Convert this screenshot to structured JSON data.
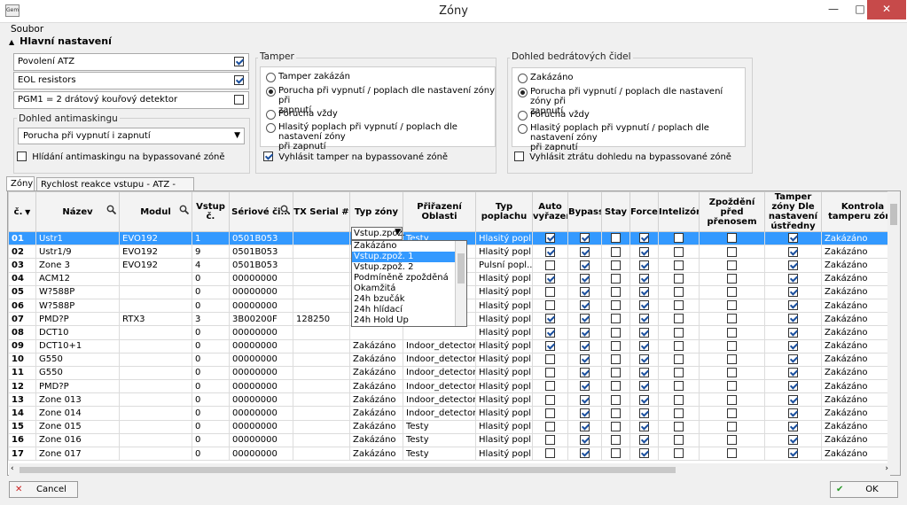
{
  "window": {
    "title": "Zóny",
    "app_icon": "Gem",
    "min": "—",
    "max": "□",
    "close": "✕"
  },
  "menu": {
    "file": "Soubor"
  },
  "main_section": {
    "title": "Hlavní nastavení",
    "collapse_arrow": "▲"
  },
  "left": {
    "items": [
      {
        "label": "Povolení ATZ",
        "checked": true
      },
      {
        "label": "EOL resistors",
        "checked": true
      },
      {
        "label": "PGM1 = 2 drátový kouřový detektor",
        "checked": false
      }
    ],
    "antimask_label": "Dohled antimaskingu",
    "antimask_value": "Porucha při vypnutí i zapnutí",
    "antimask_bypass": "Hlídání antimaskingu na bypassované zóně"
  },
  "tamper": {
    "label": "Tamper",
    "options": [
      {
        "l1": "Tamper zakázán",
        "l2": "",
        "selected": false
      },
      {
        "l1": "Porucha při vypnutí / poplach dle nastavení zóny při",
        "l2": "zapnutí",
        "selected": true
      },
      {
        "l1": "Porucha vždy",
        "l2": "",
        "selected": false
      },
      {
        "l1": "Hlasitý poplach při vypnutí /  poplach dle nastavení zóny",
        "l2": "při zapnutí",
        "selected": false
      }
    ],
    "bypass": "Vyhlásit tamper na bypassované zóně"
  },
  "supervision": {
    "label": "Dohled bedrátových čidel",
    "options": [
      {
        "l1": "Zakázáno",
        "l2": "",
        "selected": false
      },
      {
        "l1": "Porucha při vypnutí / poplach dle nastavení zóny při",
        "l2": "zapnutí",
        "selected": true
      },
      {
        "l1": "Porucha vždy",
        "l2": "",
        "selected": false
      },
      {
        "l1": "Hlasitý poplach při vypnutí /  poplach dle nastavení zóny",
        "l2": "při zapnutí",
        "selected": false
      }
    ],
    "bypass": "Vyhlásit ztrátu dohledu na bypassované zóně"
  },
  "tabs": [
    "Zóny",
    "Rychlost reakce vstupu - ATZ - EOL"
  ],
  "columns": [
    "č.",
    "Název",
    "Modul",
    "Vstup č.",
    "Sériové či...",
    "TX Serial #",
    "Typ zóny",
    "Přiřazení Oblasti",
    "Typ poplachu",
    "Auto vyřazení",
    "Bypass",
    "Stay",
    "Force",
    "Intelizóna",
    "Zpoždění před přenosem",
    "Tamper zóny Dle nastavení ústředny",
    "Kontrola tamperu zóny"
  ],
  "rows": [
    {
      "n": "01",
      "name": "Ustr1",
      "mod": "EVO192",
      "in": "1",
      "ser": "0501B053",
      "tx": "",
      "type": "Vstup.zpož.",
      "area": "Testy",
      "alarm": "Hlasitý popl...",
      "c": [
        1,
        1,
        0,
        1,
        0,
        0,
        1
      ],
      "tam": "Zakázáno"
    },
    {
      "n": "02",
      "name": "Ustr1/9",
      "mod": "EVO192",
      "in": "9",
      "ser": "0501B053",
      "tx": "",
      "type": "",
      "area": "",
      "alarm": "Hlasitý popl...",
      "c": [
        1,
        1,
        0,
        1,
        0,
        0,
        1
      ],
      "tam": "Zakázáno"
    },
    {
      "n": "03",
      "name": "Zone 3",
      "mod": "EVO192",
      "in": "4",
      "ser": "0501B053",
      "tx": "",
      "type": "",
      "area": "",
      "alarm": "Pulsní popl...",
      "c": [
        0,
        1,
        0,
        1,
        0,
        0,
        1
      ],
      "tam": "Zakázáno"
    },
    {
      "n": "04",
      "name": "ACM12",
      "mod": "",
      "in": "0",
      "ser": "00000000",
      "tx": "",
      "type": "",
      "area": "",
      "alarm": "Hlasitý popl...",
      "c": [
        1,
        1,
        0,
        1,
        0,
        0,
        1
      ],
      "tam": "Zakázáno"
    },
    {
      "n": "05",
      "name": "W?588P",
      "mod": "",
      "in": "0",
      "ser": "00000000",
      "tx": "",
      "type": "",
      "area": "",
      "alarm": "Hlasitý popl...",
      "c": [
        0,
        1,
        0,
        1,
        0,
        0,
        1
      ],
      "tam": "Zakázáno"
    },
    {
      "n": "06",
      "name": "W?588P",
      "mod": "",
      "in": "0",
      "ser": "00000000",
      "tx": "",
      "type": "",
      "area": "",
      "alarm": "Hlasitý popl...",
      "c": [
        0,
        1,
        0,
        1,
        0,
        0,
        1
      ],
      "tam": "Zakázáno"
    },
    {
      "n": "07",
      "name": "PMD?P",
      "mod": "RTX3",
      "in": "3",
      "ser": "3B00200F",
      "tx": "128250",
      "type": "",
      "area": "",
      "alarm": "Hlasitý popl...",
      "c": [
        1,
        1,
        0,
        1,
        0,
        0,
        1
      ],
      "tam": "Zakázáno"
    },
    {
      "n": "08",
      "name": "DCT10",
      "mod": "",
      "in": "0",
      "ser": "00000000",
      "tx": "",
      "type": "",
      "area": "",
      "alarm": "Hlasitý popl...",
      "c": [
        1,
        1,
        0,
        1,
        0,
        0,
        1
      ],
      "tam": "Zakázáno"
    },
    {
      "n": "09",
      "name": "DCT10+1",
      "mod": "",
      "in": "0",
      "ser": "00000000",
      "tx": "",
      "type": "Zakázáno",
      "area": "Indoor_detector",
      "alarm": "Hlasitý popl...",
      "c": [
        1,
        1,
        0,
        1,
        0,
        0,
        1
      ],
      "tam": "Zakázáno"
    },
    {
      "n": "10",
      "name": "G550",
      "mod": "",
      "in": "0",
      "ser": "00000000",
      "tx": "",
      "type": "Zakázáno",
      "area": "Indoor_detector",
      "alarm": "Hlasitý popl...",
      "c": [
        0,
        1,
        0,
        1,
        0,
        0,
        1
      ],
      "tam": "Zakázáno"
    },
    {
      "n": "11",
      "name": "G550",
      "mod": "",
      "in": "0",
      "ser": "00000000",
      "tx": "",
      "type": "Zakázáno",
      "area": "Indoor_detector",
      "alarm": "Hlasitý popl...",
      "c": [
        0,
        1,
        0,
        1,
        0,
        0,
        1
      ],
      "tam": "Zakázáno"
    },
    {
      "n": "12",
      "name": "PMD?P",
      "mod": "",
      "in": "0",
      "ser": "00000000",
      "tx": "",
      "type": "Zakázáno",
      "area": "Indoor_detector",
      "alarm": "Hlasitý popl...",
      "c": [
        0,
        1,
        0,
        1,
        0,
        0,
        1
      ],
      "tam": "Zakázáno"
    },
    {
      "n": "13",
      "name": "Zone 013",
      "mod": "",
      "in": "0",
      "ser": "00000000",
      "tx": "",
      "type": "Zakázáno",
      "area": "Indoor_detector",
      "alarm": "Hlasitý popl...",
      "c": [
        0,
        1,
        0,
        1,
        0,
        0,
        1
      ],
      "tam": "Zakázáno"
    },
    {
      "n": "14",
      "name": "Zone 014",
      "mod": "",
      "in": "0",
      "ser": "00000000",
      "tx": "",
      "type": "Zakázáno",
      "area": "Indoor_detector",
      "alarm": "Hlasitý popl...",
      "c": [
        0,
        1,
        0,
        1,
        0,
        0,
        1
      ],
      "tam": "Zakázáno"
    },
    {
      "n": "15",
      "name": "Zone 015",
      "mod": "",
      "in": "0",
      "ser": "00000000",
      "tx": "",
      "type": "Zakázáno",
      "area": "Testy",
      "alarm": "Hlasitý popl...",
      "c": [
        0,
        1,
        0,
        1,
        0,
        0,
        1
      ],
      "tam": "Zakázáno"
    },
    {
      "n": "16",
      "name": "Zone 016",
      "mod": "",
      "in": "0",
      "ser": "00000000",
      "tx": "",
      "type": "Zakázáno",
      "area": "Testy",
      "alarm": "Hlasitý popl...",
      "c": [
        0,
        1,
        0,
        1,
        0,
        0,
        1
      ],
      "tam": "Zakázáno"
    },
    {
      "n": "17",
      "name": "Zone 017",
      "mod": "",
      "in": "0",
      "ser": "00000000",
      "tx": "",
      "type": "Zakázáno",
      "area": "Testy",
      "alarm": "Hlasitý popl...",
      "c": [
        0,
        1,
        0,
        1,
        0,
        0,
        1
      ],
      "tam": "Zakázáno"
    }
  ],
  "dropdown": {
    "current": "Vstup.zpož.",
    "options": [
      "Zakázáno",
      "Vstup.zpož. 1",
      "Vstup.zpož. 2",
      "Podmíněně zpožděná",
      "Okamžitá",
      "24h bzučák",
      "24h hlídací",
      "24h Hold Up"
    ],
    "highlighted": 1
  },
  "buttons": {
    "cancel": "Cancel",
    "ok": "OK"
  },
  "colors": {
    "selection": "#3399ff",
    "cancel_icon": "#cc2222",
    "ok_icon": "#2a9a2a"
  }
}
